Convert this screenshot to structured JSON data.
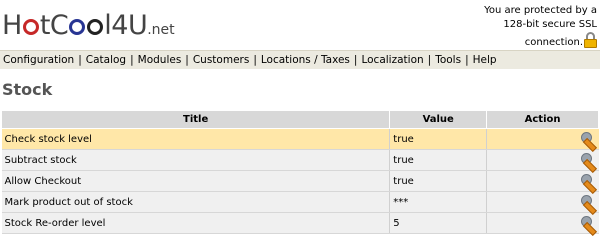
{
  "header": {
    "logo_prefix": "H",
    "logo_middle": "tC",
    "logo_middle2": "l4U",
    "logo_tld": ".net",
    "ssl_line1": "You are protected by a",
    "ssl_line2": "128-bit secure SSL",
    "ssl_line3": "connection."
  },
  "menu": {
    "items": [
      {
        "label": "Configuration"
      },
      {
        "label": "Catalog"
      },
      {
        "label": "Modules"
      },
      {
        "label": "Customers"
      },
      {
        "label": "Locations / Taxes"
      },
      {
        "label": "Localization"
      },
      {
        "label": "Tools"
      },
      {
        "label": "Help"
      }
    ],
    "separator": "|"
  },
  "page": {
    "title": "Stock"
  },
  "table": {
    "headers": {
      "title": "Title",
      "value": "Value",
      "action": "Action"
    },
    "rows": [
      {
        "title": "Check stock level",
        "value": "true",
        "selected": true
      },
      {
        "title": "Subtract stock",
        "value": "true",
        "selected": false
      },
      {
        "title": "Allow Checkout",
        "value": "true",
        "selected": false
      },
      {
        "title": "Mark product out of stock",
        "value": "***",
        "selected": false
      },
      {
        "title": "Stock Re-order level",
        "value": "5",
        "selected": false
      }
    ]
  },
  "colors": {
    "menu_bg": "#eceae0",
    "selected_row": "#ffe7a8",
    "header_bg": "#d8d8d8",
    "row_bg": "#f0f0f0"
  },
  "icons": {
    "lock": "lock-icon",
    "edit": "edit-wrench-icon"
  }
}
